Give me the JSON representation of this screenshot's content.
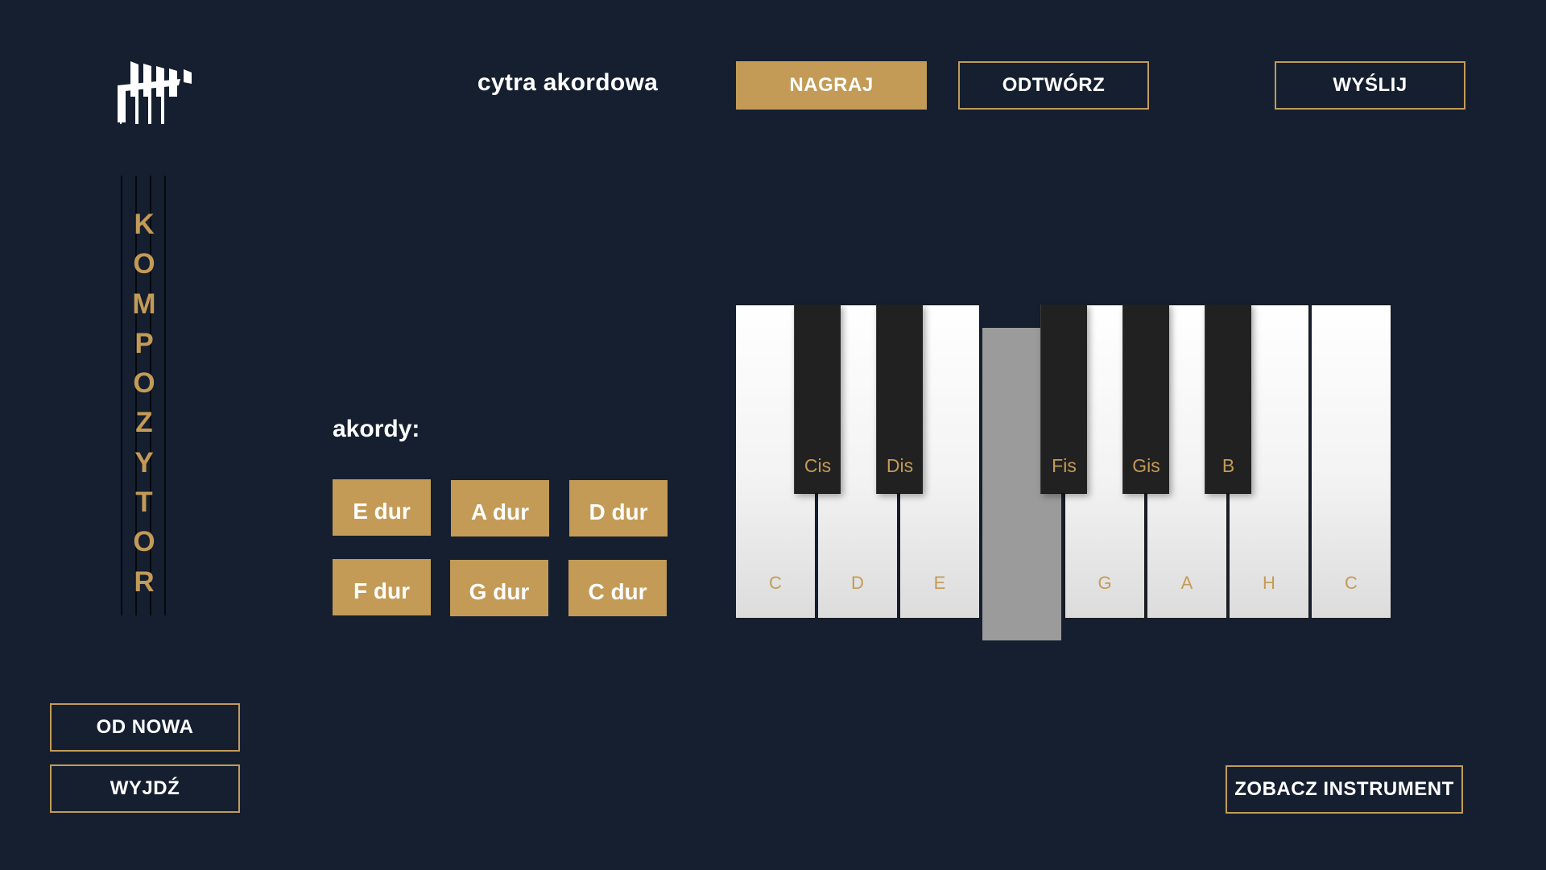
{
  "header": {
    "instrument_name": "cytra akordowa",
    "record_label": "NAGRAJ",
    "play_label": "ODTWÓRZ",
    "send_label": "WYŚLIJ"
  },
  "sidebar": {
    "title_letters": [
      "K",
      "O",
      "M",
      "P",
      "O",
      "Z",
      "Y",
      "T",
      "O",
      "R"
    ],
    "restart_label": "OD NOWA",
    "exit_label": "WYJDŹ"
  },
  "chords": {
    "label": "akordy:",
    "items": [
      "E dur",
      "A dur",
      "D dur",
      "F dur",
      "G dur",
      "C dur"
    ]
  },
  "keyboard": {
    "white_keys": [
      "C",
      "D",
      "E",
      "",
      "G",
      "A",
      "H",
      "C"
    ],
    "active_white_key_index": 3,
    "black_keys": [
      "Cis",
      "Dis",
      "Fis",
      "Gis",
      "B"
    ]
  },
  "footer": {
    "see_instrument_label": "ZOBACZ INSTRUMENT"
  },
  "colors": {
    "background": "#151f2f",
    "accent_gold": "#c39b57",
    "black_key": "#222121",
    "pressed_key": "#9b9b9b"
  },
  "icons": {
    "logo": "museum-pillars-logo-icon"
  }
}
